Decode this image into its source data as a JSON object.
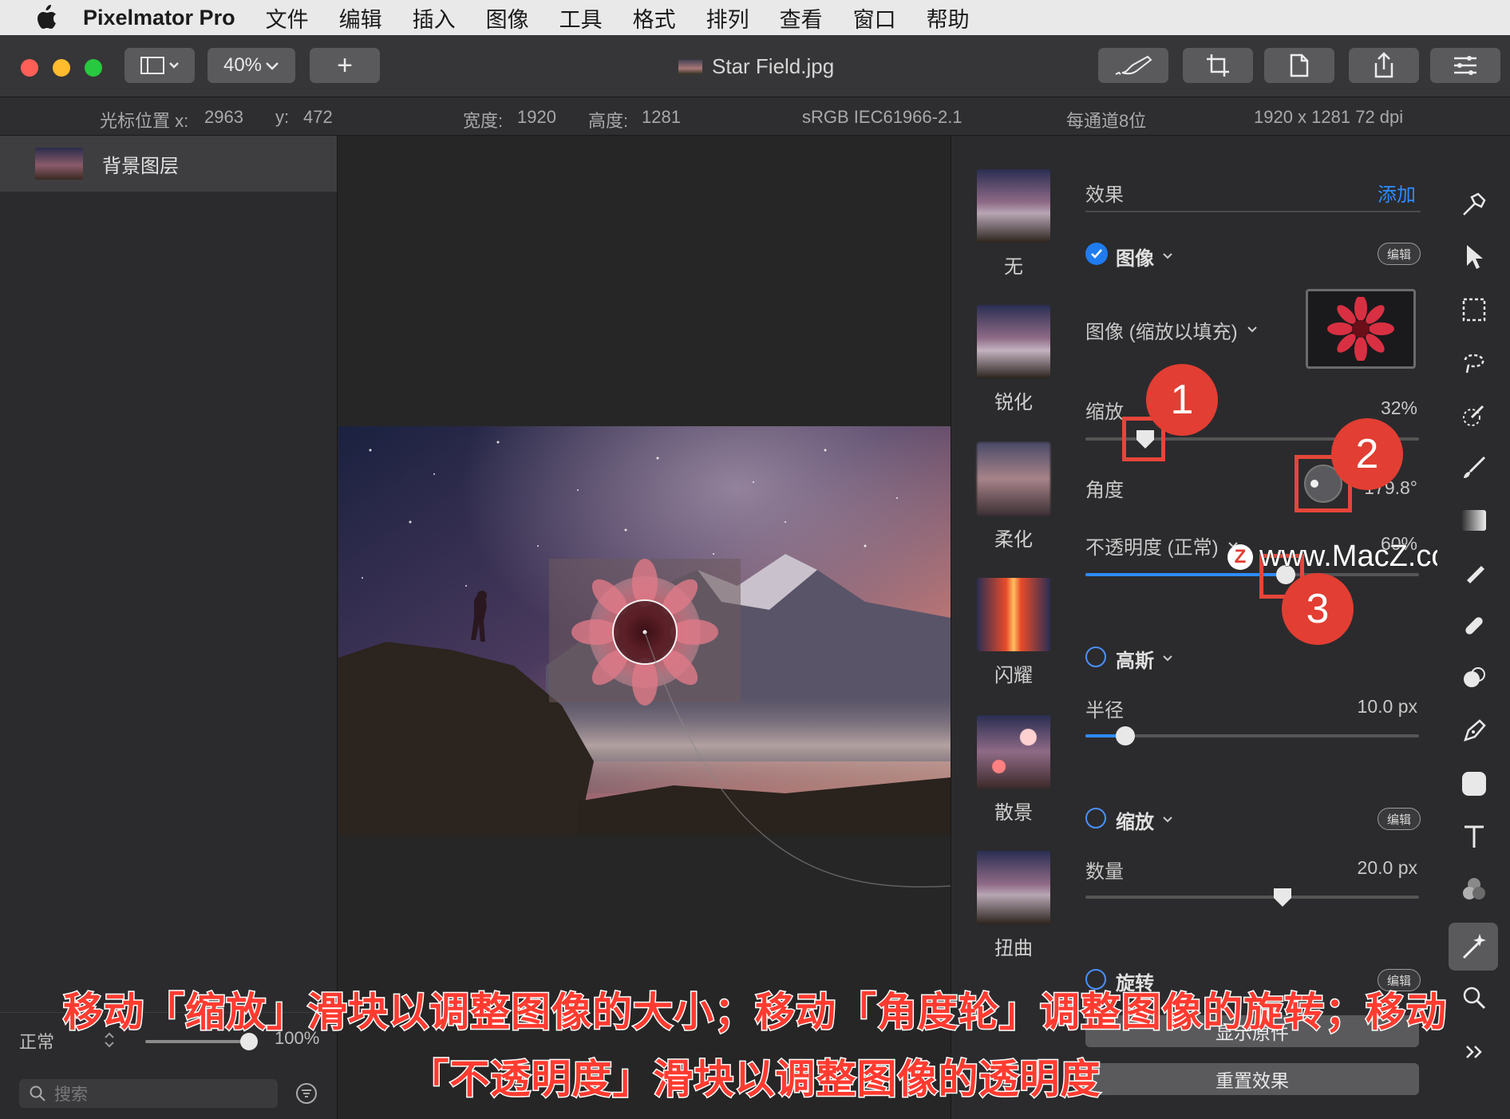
{
  "menubar": {
    "app_name": "Pixelmator Pro",
    "items": [
      "文件",
      "编辑",
      "插入",
      "图像",
      "工具",
      "格式",
      "排列",
      "查看",
      "窗口",
      "帮助"
    ]
  },
  "toolbar": {
    "zoom": "40%",
    "add": "+",
    "file_title": "Star Field.jpg"
  },
  "info": {
    "cursor_x_label": "光标位置 x:",
    "cursor_x": "2963",
    "cursor_y_label": "y:",
    "cursor_y": "472",
    "width_label": "宽度:",
    "width": "1920",
    "height_label": "高度:",
    "height": "1281",
    "color_profile": "sRGB IEC61966-2.1",
    "bit_depth": "每通道8位",
    "resolution": "1920 x 1281 72 dpi"
  },
  "layers": {
    "background_layer": "背景图层",
    "blend_mode": "正常",
    "opacity": "100%",
    "opacity_value": 1.0,
    "search_placeholder": "搜索"
  },
  "effects_browser": [
    "无",
    "锐化",
    "柔化",
    "闪耀",
    "散景",
    "扭曲"
  ],
  "effects_panel": {
    "header": "效果",
    "add": "添加",
    "image_section": "图像",
    "edit": "编辑",
    "image_mode": "图像 (缩放以填充)",
    "scale_label": "缩放",
    "scale_value": "32%",
    "scale_fraction": 0.18,
    "angle_label": "角度",
    "angle_value": "179.8°",
    "opacity_label": "不透明度 (正常)",
    "opacity_value": "60%",
    "opacity_fraction": 0.6,
    "gaussian_section": "高斯",
    "radius_label": "半径",
    "radius_value": "10.0 px",
    "radius_fraction": 0.12,
    "zoom_section": "缩放",
    "amount_label": "数量",
    "amount_value": "20.0 px",
    "amount_fraction": 0.59,
    "rotate_section": "旋转",
    "show_original": "显示原件",
    "reset": "重置效果"
  },
  "callouts": [
    "1",
    "2",
    "3"
  ],
  "watermark": "www.MacZ.com",
  "caption": {
    "line1": "移动「缩放」滑块以调整图像的大小；移动「角度轮」调整图像的旋转；移动",
    "line2": "「不透明度」滑块以调整图像的透明度"
  }
}
